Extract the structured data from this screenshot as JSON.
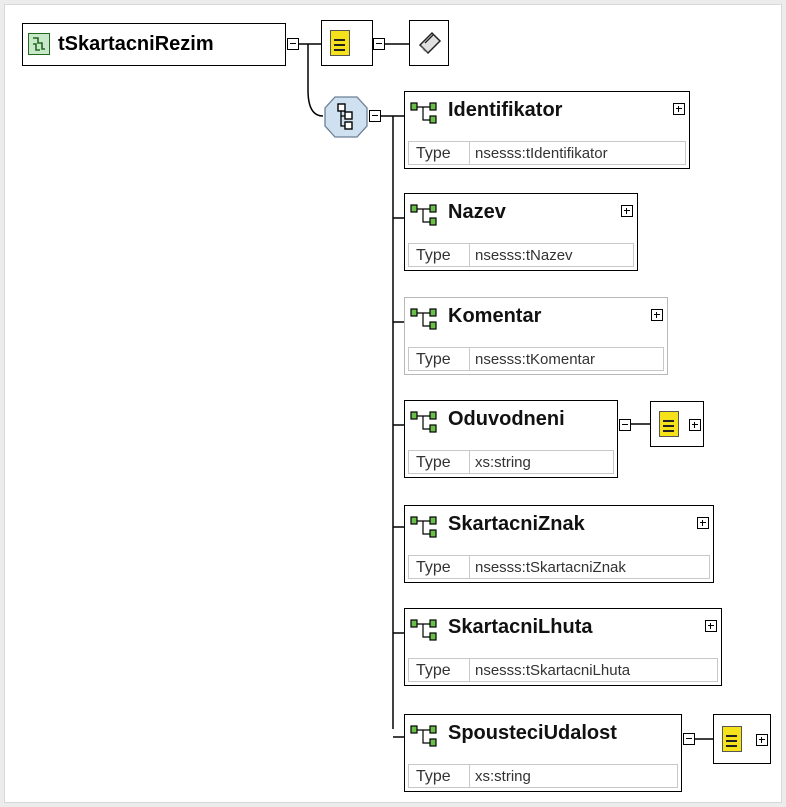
{
  "root": {
    "name": "tSkartacniRezim"
  },
  "compositor": {
    "kind": "sequence",
    "icon": "sequence-compositor-icon"
  },
  "type_key_label": "Type",
  "elements": [
    {
      "name": "Identifikator",
      "type": "nsesss:tIdentifikator",
      "optional": false,
      "has_annotation": false
    },
    {
      "name": "Nazev",
      "type": "nsesss:tNazev",
      "optional": false,
      "has_annotation": false
    },
    {
      "name": "Komentar",
      "type": "nsesss:tKomentar",
      "optional": true,
      "has_annotation": false
    },
    {
      "name": "Oduvodneni",
      "type": "xs:string",
      "optional": false,
      "has_annotation": true
    },
    {
      "name": "SkartacniZnak",
      "type": "nsesss:tSkartacniZnak",
      "optional": false,
      "has_annotation": false
    },
    {
      "name": "SkartacniLhuta",
      "type": "nsesss:tSkartacniLhuta",
      "optional": false,
      "has_annotation": false
    },
    {
      "name": "SpousteciUdalost",
      "type": "xs:string",
      "optional": false,
      "has_annotation": true
    }
  ],
  "colors": {
    "annotation_doc": "#f6e21a",
    "compositor_fill": "#cfe0f0",
    "element_icon_green": "#2e7d32",
    "root_icon_fill": "#c9e8c9"
  }
}
